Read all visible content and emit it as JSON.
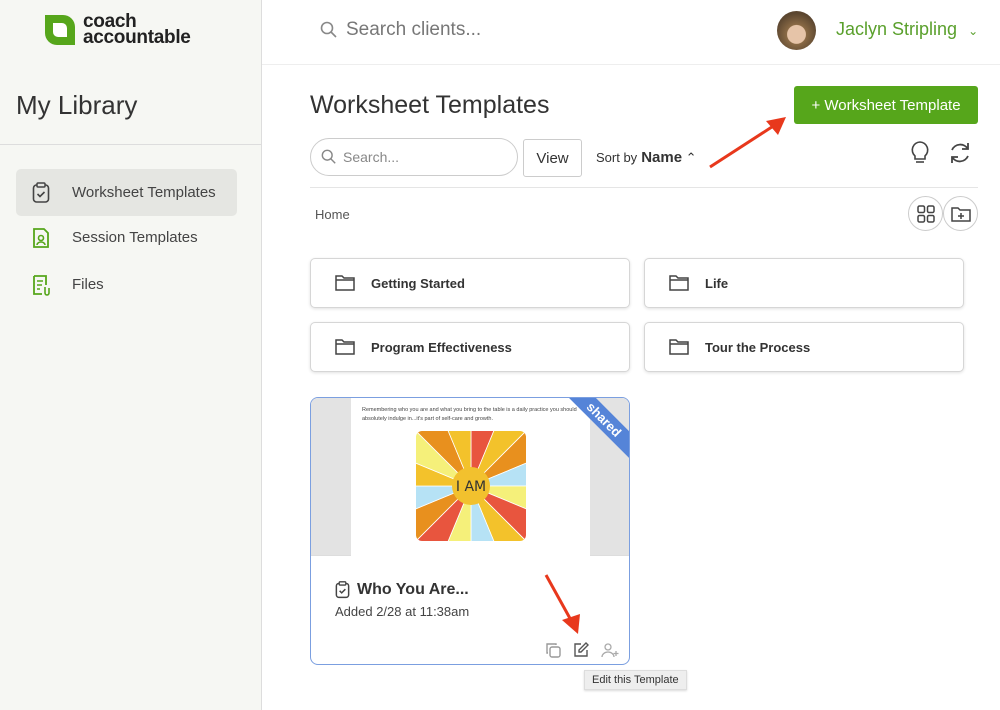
{
  "app": {
    "logo_line1": "coach",
    "logo_line2": "accountable",
    "brand_color": "#56a61b"
  },
  "sidebar": {
    "title": "My Library",
    "items": [
      {
        "label": "Worksheet Templates",
        "icon": "clipboard-check-icon",
        "active": true
      },
      {
        "label": "Session Templates",
        "icon": "user-document-icon"
      },
      {
        "label": "Files",
        "icon": "file-clip-icon"
      }
    ]
  },
  "topbar": {
    "search_placeholder": "Search clients...",
    "user_name": "Jaclyn Stripling"
  },
  "main": {
    "title": "Worksheet Templates",
    "add_button": "+ Worksheet Template",
    "search_placeholder": "Search...",
    "view_button": "View",
    "sort_label": "Sort by",
    "sort_value": "Name",
    "breadcrumb": "Home",
    "folders": [
      "Getting Started",
      "Life",
      "Program Effectiveness",
      "Tour the Process"
    ],
    "card": {
      "title": "Who You Are...",
      "added": "Added 2/28 at 11:38am",
      "badge": "shared",
      "preview_text": "Remembering who you are and what you bring to the table is a daily practice you should absolutely indulge in...it's part of self-care and growth.",
      "preview_center": "I AM"
    },
    "tooltip": "Edit this Template"
  }
}
